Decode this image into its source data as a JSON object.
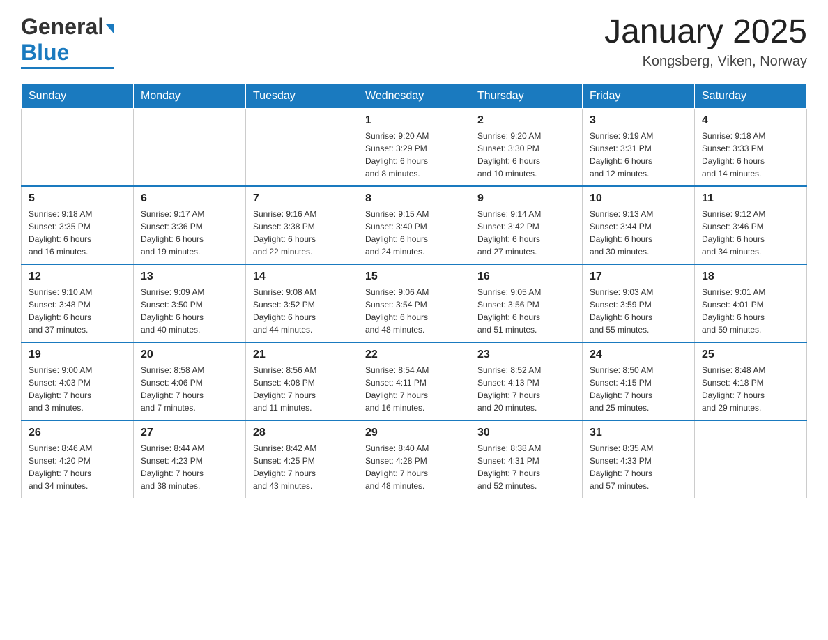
{
  "header": {
    "logo_general": "General",
    "logo_blue": "Blue",
    "month_title": "January 2025",
    "location": "Kongsberg, Viken, Norway"
  },
  "days_of_week": [
    "Sunday",
    "Monday",
    "Tuesday",
    "Wednesday",
    "Thursday",
    "Friday",
    "Saturday"
  ],
  "weeks": [
    [
      {
        "day": "",
        "info": ""
      },
      {
        "day": "",
        "info": ""
      },
      {
        "day": "",
        "info": ""
      },
      {
        "day": "1",
        "info": "Sunrise: 9:20 AM\nSunset: 3:29 PM\nDaylight: 6 hours\nand 8 minutes."
      },
      {
        "day": "2",
        "info": "Sunrise: 9:20 AM\nSunset: 3:30 PM\nDaylight: 6 hours\nand 10 minutes."
      },
      {
        "day": "3",
        "info": "Sunrise: 9:19 AM\nSunset: 3:31 PM\nDaylight: 6 hours\nand 12 minutes."
      },
      {
        "day": "4",
        "info": "Sunrise: 9:18 AM\nSunset: 3:33 PM\nDaylight: 6 hours\nand 14 minutes."
      }
    ],
    [
      {
        "day": "5",
        "info": "Sunrise: 9:18 AM\nSunset: 3:35 PM\nDaylight: 6 hours\nand 16 minutes."
      },
      {
        "day": "6",
        "info": "Sunrise: 9:17 AM\nSunset: 3:36 PM\nDaylight: 6 hours\nand 19 minutes."
      },
      {
        "day": "7",
        "info": "Sunrise: 9:16 AM\nSunset: 3:38 PM\nDaylight: 6 hours\nand 22 minutes."
      },
      {
        "day": "8",
        "info": "Sunrise: 9:15 AM\nSunset: 3:40 PM\nDaylight: 6 hours\nand 24 minutes."
      },
      {
        "day": "9",
        "info": "Sunrise: 9:14 AM\nSunset: 3:42 PM\nDaylight: 6 hours\nand 27 minutes."
      },
      {
        "day": "10",
        "info": "Sunrise: 9:13 AM\nSunset: 3:44 PM\nDaylight: 6 hours\nand 30 minutes."
      },
      {
        "day": "11",
        "info": "Sunrise: 9:12 AM\nSunset: 3:46 PM\nDaylight: 6 hours\nand 34 minutes."
      }
    ],
    [
      {
        "day": "12",
        "info": "Sunrise: 9:10 AM\nSunset: 3:48 PM\nDaylight: 6 hours\nand 37 minutes."
      },
      {
        "day": "13",
        "info": "Sunrise: 9:09 AM\nSunset: 3:50 PM\nDaylight: 6 hours\nand 40 minutes."
      },
      {
        "day": "14",
        "info": "Sunrise: 9:08 AM\nSunset: 3:52 PM\nDaylight: 6 hours\nand 44 minutes."
      },
      {
        "day": "15",
        "info": "Sunrise: 9:06 AM\nSunset: 3:54 PM\nDaylight: 6 hours\nand 48 minutes."
      },
      {
        "day": "16",
        "info": "Sunrise: 9:05 AM\nSunset: 3:56 PM\nDaylight: 6 hours\nand 51 minutes."
      },
      {
        "day": "17",
        "info": "Sunrise: 9:03 AM\nSunset: 3:59 PM\nDaylight: 6 hours\nand 55 minutes."
      },
      {
        "day": "18",
        "info": "Sunrise: 9:01 AM\nSunset: 4:01 PM\nDaylight: 6 hours\nand 59 minutes."
      }
    ],
    [
      {
        "day": "19",
        "info": "Sunrise: 9:00 AM\nSunset: 4:03 PM\nDaylight: 7 hours\nand 3 minutes."
      },
      {
        "day": "20",
        "info": "Sunrise: 8:58 AM\nSunset: 4:06 PM\nDaylight: 7 hours\nand 7 minutes."
      },
      {
        "day": "21",
        "info": "Sunrise: 8:56 AM\nSunset: 4:08 PM\nDaylight: 7 hours\nand 11 minutes."
      },
      {
        "day": "22",
        "info": "Sunrise: 8:54 AM\nSunset: 4:11 PM\nDaylight: 7 hours\nand 16 minutes."
      },
      {
        "day": "23",
        "info": "Sunrise: 8:52 AM\nSunset: 4:13 PM\nDaylight: 7 hours\nand 20 minutes."
      },
      {
        "day": "24",
        "info": "Sunrise: 8:50 AM\nSunset: 4:15 PM\nDaylight: 7 hours\nand 25 minutes."
      },
      {
        "day": "25",
        "info": "Sunrise: 8:48 AM\nSunset: 4:18 PM\nDaylight: 7 hours\nand 29 minutes."
      }
    ],
    [
      {
        "day": "26",
        "info": "Sunrise: 8:46 AM\nSunset: 4:20 PM\nDaylight: 7 hours\nand 34 minutes."
      },
      {
        "day": "27",
        "info": "Sunrise: 8:44 AM\nSunset: 4:23 PM\nDaylight: 7 hours\nand 38 minutes."
      },
      {
        "day": "28",
        "info": "Sunrise: 8:42 AM\nSunset: 4:25 PM\nDaylight: 7 hours\nand 43 minutes."
      },
      {
        "day": "29",
        "info": "Sunrise: 8:40 AM\nSunset: 4:28 PM\nDaylight: 7 hours\nand 48 minutes."
      },
      {
        "day": "30",
        "info": "Sunrise: 8:38 AM\nSunset: 4:31 PM\nDaylight: 7 hours\nand 52 minutes."
      },
      {
        "day": "31",
        "info": "Sunrise: 8:35 AM\nSunset: 4:33 PM\nDaylight: 7 hours\nand 57 minutes."
      },
      {
        "day": "",
        "info": ""
      }
    ]
  ]
}
